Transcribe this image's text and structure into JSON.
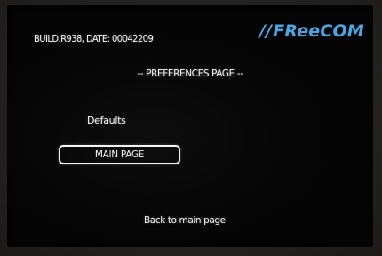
{
  "header": {
    "build_info": "BUILD.R938, DATE: 00042209",
    "brand_slashes": "//",
    "brand_name": "FReeCOM"
  },
  "page": {
    "title": "-- PREFERENCES PAGE --"
  },
  "settings": {
    "defaults_label": "Defaults"
  },
  "navigation": {
    "main_page_button": "MAIN PAGE",
    "back_link": "Back to main page"
  },
  "colors": {
    "screen_background": "#040404",
    "text": "#f2f2f2",
    "brand": "#4aa6e2"
  }
}
